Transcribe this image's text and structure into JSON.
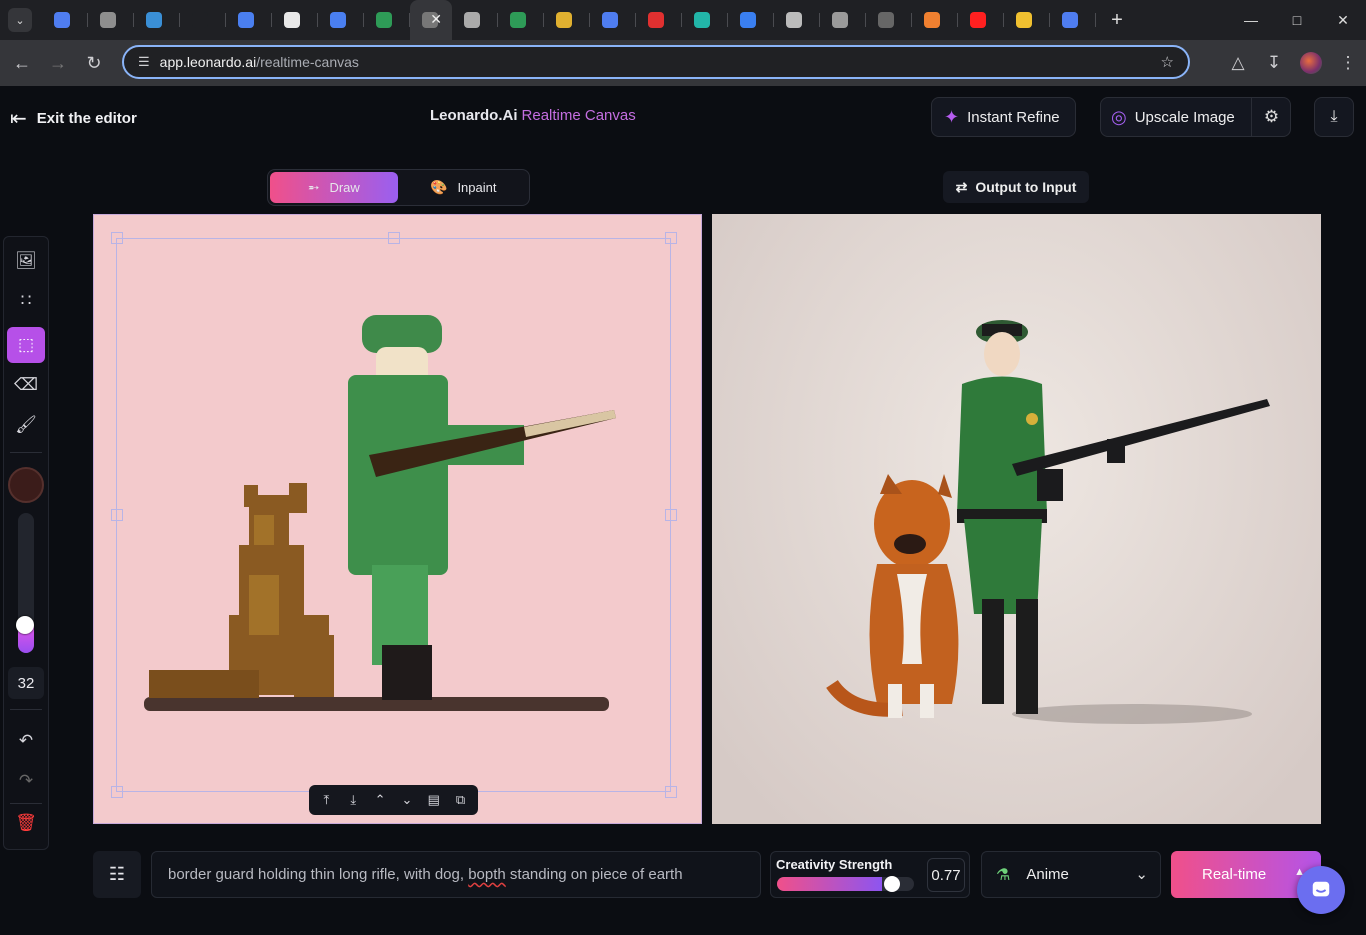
{
  "browser": {
    "tab_favicons": [
      {
        "name": "search-tab",
        "color": "#4f7df0"
      },
      {
        "name": "circle-tab",
        "color": "#8e8e8e"
      },
      {
        "name": "tool-tab",
        "color": "#3a8fd6"
      },
      {
        "name": "blank-tab",
        "color": "#1f2024"
      },
      {
        "name": "puzzle-tab",
        "color": "#4a7ff0"
      },
      {
        "name": "openai-tab",
        "color": "#e8e8e8"
      },
      {
        "name": "translate-tab",
        "color": "#4a7ff0"
      },
      {
        "name": "leonardo-tab",
        "color": "#2e9b57"
      },
      {
        "name": "active-tab",
        "color": "#35363a"
      },
      {
        "name": "globe-tab",
        "color": "#aaaaaa"
      },
      {
        "name": "leonardo-tab-2",
        "color": "#2e9b57"
      },
      {
        "name": "book-tab",
        "color": "#e0b030"
      },
      {
        "name": "list-tab",
        "color": "#4f7df0"
      },
      {
        "name": "red-tab",
        "color": "#e03030"
      },
      {
        "name": "diamond-tab",
        "color": "#22b5a8"
      },
      {
        "name": "blue-diamond-tab",
        "color": "#3a7ff0"
      },
      {
        "name": "b-tab",
        "color": "#bbbbbb"
      },
      {
        "name": "m-tab",
        "color": "#9a9a9a"
      },
      {
        "name": "github-tab",
        "color": "#666666"
      },
      {
        "name": "stackoverflow-tab",
        "color": "#f08030"
      },
      {
        "name": "youtube-tab",
        "color": "#ff2020"
      },
      {
        "name": "emoji-tab",
        "color": "#f0c030"
      },
      {
        "name": "google-tab",
        "color": "#4f7df0"
      }
    ],
    "url_host": "app.leonardo.ai",
    "url_path": "/realtime-canvas"
  },
  "header": {
    "exit_label": "Exit the editor",
    "title": "Leonardo.Ai",
    "title_sub": "Realtime Canvas",
    "instant_refine_label": "Instant Refine",
    "upscale_label": "Upscale Image"
  },
  "modes": {
    "draw_label": "Draw",
    "inpaint_label": "Inpaint",
    "active": "Draw"
  },
  "output_to_input_label": "Output to Input",
  "tools": {
    "brush_color": "#3b1c1a",
    "brush_size": "32",
    "size_slider_fraction": 0.2
  },
  "bottom": {
    "prompt_before": "border guard holding thin long rifle, with dog, ",
    "prompt_misspelled": "bopth",
    "prompt_after": " standing on piece of earth",
    "creativity_label": "Creativity Strength",
    "creativity_value": "0.77",
    "creativity_fraction": 0.77,
    "style_label": "Anime",
    "realtime_label": "Real-time"
  },
  "colors": {
    "accent_pink": "#f0508a",
    "accent_purple": "#9a5ff0",
    "canvas_pink": "#f3cacc"
  }
}
